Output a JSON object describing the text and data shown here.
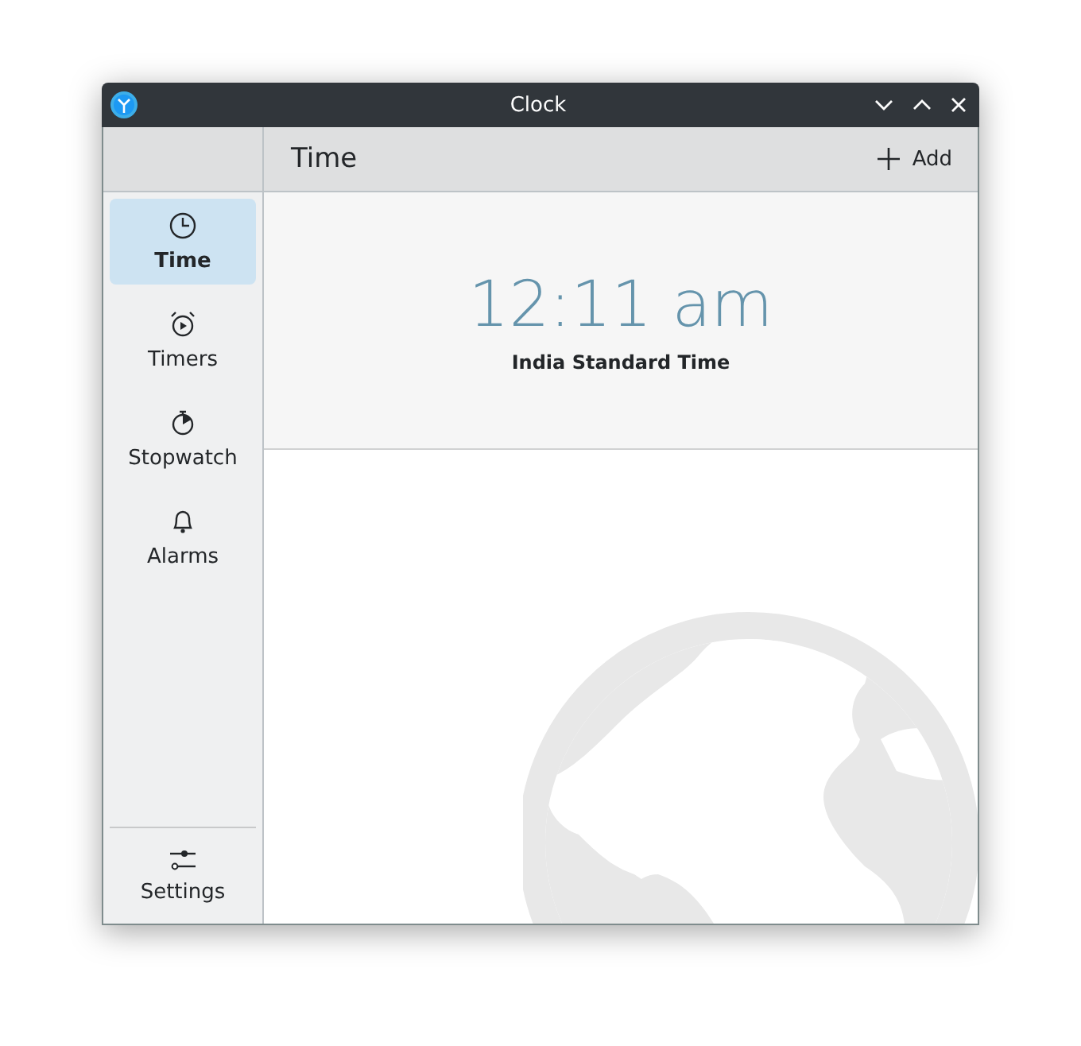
{
  "window": {
    "title": "Clock"
  },
  "sidebar": {
    "items": [
      {
        "label": "Time",
        "selected": true
      },
      {
        "label": "Timers",
        "selected": false
      },
      {
        "label": "Stopwatch",
        "selected": false
      },
      {
        "label": "Alarms",
        "selected": false
      }
    ],
    "footer": {
      "label": "Settings"
    }
  },
  "header": {
    "title": "Time",
    "add_button": "Add"
  },
  "clock": {
    "time": "12:11 am",
    "timezone": "India Standard Time"
  }
}
